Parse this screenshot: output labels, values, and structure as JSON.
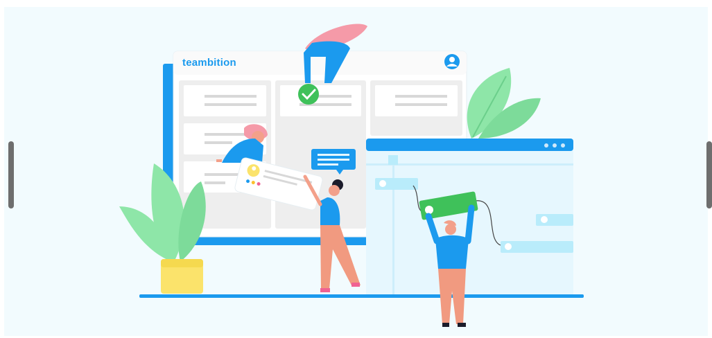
{
  "brand": {
    "name": "teambition"
  },
  "colors": {
    "primary_blue": "#1b9aee",
    "light_blue": "#b9ecfb",
    "green": "#3fc15a",
    "leaf_green": "#8ee6a8",
    "pot_yellow": "#fbe36b",
    "skin": "#f3a08a",
    "pants": "#f19a80",
    "hair_pink": "#f59aa8",
    "background": "#f2fbfe"
  },
  "icons": [
    "user-avatar-icon",
    "check-circle-icon",
    "window-dots-icon",
    "chat-bubble-icon"
  ]
}
